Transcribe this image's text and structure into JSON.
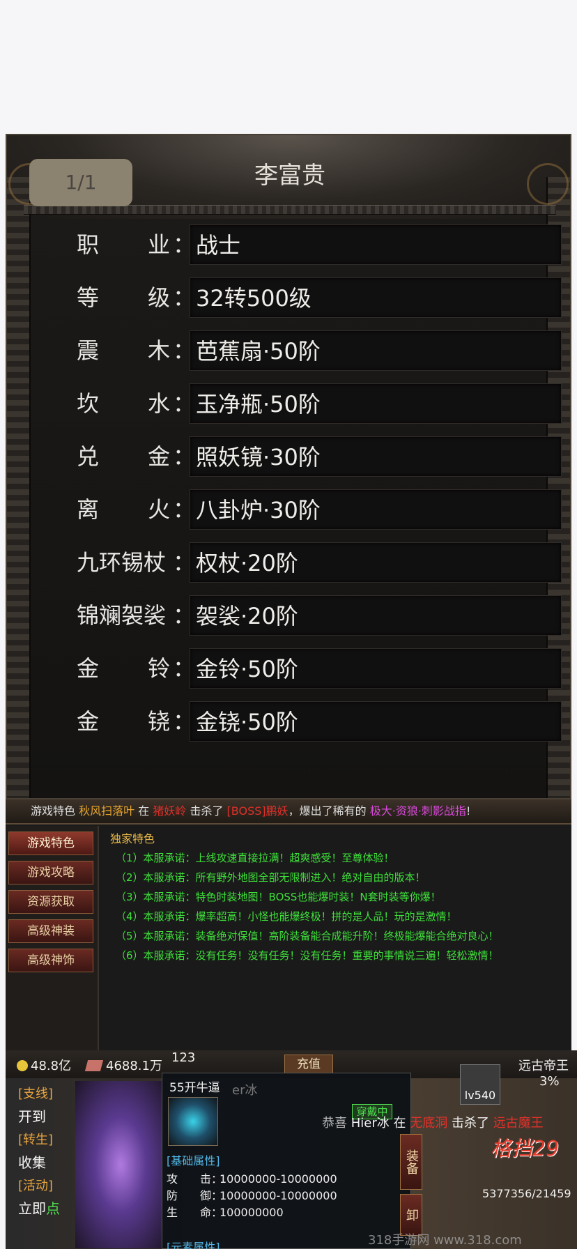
{
  "character": {
    "page_indicator": "1/1",
    "name": "李富贵",
    "rows": [
      {
        "label_a": "职",
        "label_b": "业",
        "value": "战士"
      },
      {
        "label_a": "等",
        "label_b": "级",
        "value": "32转500级"
      },
      {
        "label_a": "震",
        "label_b": "木",
        "value": "芭蕉扇·50阶"
      },
      {
        "label_a": "坎",
        "label_b": "水",
        "value": "玉净瓶·50阶"
      },
      {
        "label_a": "兑",
        "label_b": "金",
        "value": "照妖镜·30阶"
      },
      {
        "label_a": "离",
        "label_b": "火",
        "value": "八卦炉·30阶"
      },
      {
        "label_a": "九环锡杖",
        "label_b": "",
        "value": "权杖·20阶"
      },
      {
        "label_a": "锦斓袈裟",
        "label_b": "",
        "value": "袈裟·20阶"
      },
      {
        "label_a": "金",
        "label_b": "铃",
        "value": "金铃·50阶"
      },
      {
        "label_a": "金",
        "label_b": "铙",
        "value": "金铙·50阶"
      }
    ],
    "colon": "："
  },
  "features": {
    "ticker": {
      "prefix": "游戏特色",
      "player": "秋风扫落叶",
      "in_text": "在",
      "map": "猪妖岭",
      "killed": "击杀了",
      "boss": "[BOSS]鹏妖",
      "drop": "，爆出了稀有的",
      "item": "极大·资狼·刺影战指",
      "end": "!"
    },
    "sidebar": [
      "游戏特色",
      "游戏攻略",
      "资源获取",
      "高级神装",
      "高级神饰"
    ],
    "title": "独家特色",
    "lines": [
      "（1）本服承诺：上线攻速直接拉满！超爽感受！至尊体验！",
      "（2）本服承诺：所有野外地图全部无限制进入！绝对自由的版本！",
      "（3）本服承诺：特色时装地图！BOSS也能爆时装！N套时装等你爆！",
      "（4）本服承诺：爆率超高！小怪也能爆终极！拼的是人品！玩的是激情！",
      "（5）本服承诺：装备绝对保值！高阶装备能合成能升阶！终极能爆能合绝对良心！",
      "（6）本服承诺：没有任务！没有任务！没有任务！重要的事情说三遍！轻松激情！"
    ]
  },
  "hud": {
    "gold": "48.8亿",
    "ingot": "4688.1万",
    "number": "123",
    "recharge": "充值",
    "level": "lv540",
    "boss_name": "远古帝王",
    "boss_pct": "3%",
    "quests": [
      {
        "tag": "[支线]",
        "action": "开到",
        "hl": ""
      },
      {
        "tag": "[转生]",
        "action": "收集",
        "hl": ""
      },
      {
        "tag": "[活动]",
        "action": "立即",
        "hl": "点"
      }
    ],
    "tooltip": {
      "title": "55开牛逼",
      "ghost": "er冰",
      "equipped": "穿戴中",
      "section": "[基础属性]",
      "stats": [
        {
          "k": "攻　　击：",
          "v": "10000000-10000000"
        },
        {
          "k": "防　　御：",
          "v": "10000000-10000000"
        },
        {
          "k": "生　　命：",
          "v": "100000000"
        }
      ],
      "section2": "[元素属性]",
      "side_buttons": [
        "装备",
        "卸"
      ]
    },
    "kill": {
      "congrats": "恭喜",
      "player": "Hier冰",
      "at": "在",
      "map": "无底洞",
      "killed": "击杀了",
      "boss": "远古魔王"
    },
    "chat": "格挡",
    "chat_num": "29",
    "hp": "5377356/21459",
    "watermark": "318手游网 www.318.com"
  }
}
